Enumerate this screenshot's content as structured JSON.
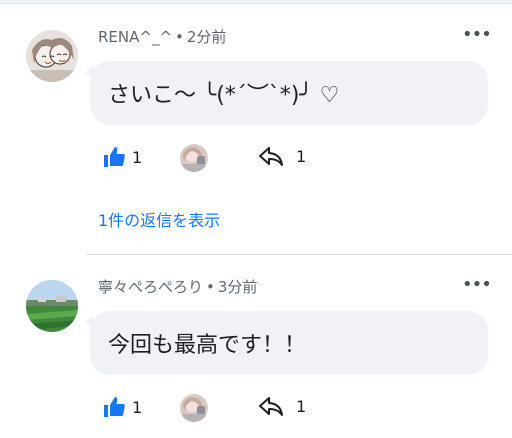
{
  "colors": {
    "accent": "#1877f2",
    "bubble": "#f0f2f5",
    "meta_text": "#606770"
  },
  "comments": [
    {
      "author": "RENA^_^",
      "time": "2分前",
      "text": "さいこ〜 ╰(*´︶`*)╯ ♡",
      "like_count": "1",
      "share_count": "1",
      "reply_link": "1件の返信を表示",
      "avatar_icon": "anime-sketch-avatar"
    },
    {
      "author": "寧々ぺろぺろり",
      "time": "3分前",
      "text": "今回も最高です！！",
      "like_count": "1",
      "share_count": "1",
      "avatar_icon": "landscape-avatar"
    }
  ],
  "icons": {
    "like": "thumbs-up-icon",
    "share": "share-arrow-icon",
    "more": "more-options-icon"
  }
}
